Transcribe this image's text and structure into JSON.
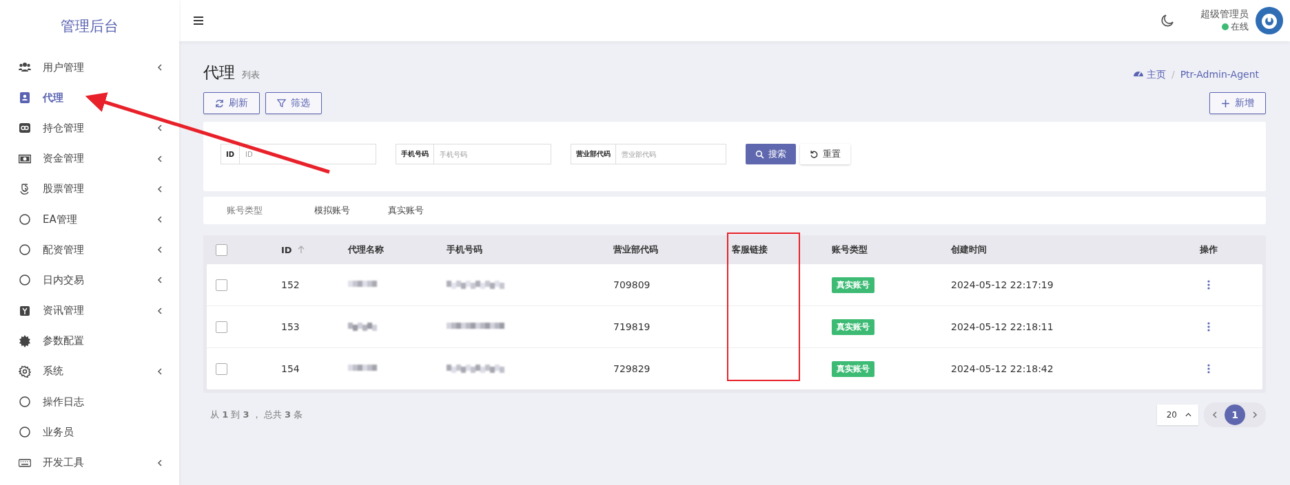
{
  "sidebar": {
    "title": "管理后台",
    "items": [
      {
        "label": "用户管理",
        "selected": false,
        "submenu": true
      },
      {
        "label": "代理",
        "selected": true,
        "submenu": false
      },
      {
        "label": "持仓管理",
        "selected": false,
        "submenu": true
      },
      {
        "label": "资金管理",
        "selected": false,
        "submenu": true
      },
      {
        "label": "股票管理",
        "selected": false,
        "submenu": true
      },
      {
        "label": "EA管理",
        "selected": false,
        "submenu": true
      },
      {
        "label": "配资管理",
        "selected": false,
        "submenu": true
      },
      {
        "label": "日内交易",
        "selected": false,
        "submenu": true
      },
      {
        "label": "资讯管理",
        "selected": false,
        "submenu": true
      },
      {
        "label": "参数配置",
        "selected": false,
        "submenu": false
      },
      {
        "label": "系统",
        "selected": false,
        "submenu": true
      },
      {
        "label": "操作日志",
        "selected": false,
        "submenu": false
      },
      {
        "label": "业务员",
        "selected": false,
        "submenu": false
      },
      {
        "label": "开发工具",
        "selected": false,
        "submenu": true
      }
    ]
  },
  "topbar": {
    "user": "超级管理员",
    "status": "在线"
  },
  "header": {
    "title": "代理",
    "subtitle": "列表",
    "breadcrumb": [
      "主页",
      "Ptr-Admin-Agent"
    ],
    "breadcrumb_separator": "/"
  },
  "toolbar": {
    "buttons": [
      "刷新",
      "筛选"
    ],
    "create": "新增"
  },
  "filters": {
    "fields": [
      {
        "label": "ID",
        "placeholder": "ID"
      },
      {
        "label": "手机号码",
        "placeholder": "手机号码"
      },
      {
        "label": "营业部代码",
        "placeholder": "营业部代码"
      }
    ],
    "search": "搜索",
    "reset": "重置"
  },
  "account_tabs": {
    "label": "账号类型",
    "tabs": [
      {
        "label": "模拟账号",
        "selected": false
      },
      {
        "label": "真实账号",
        "selected": false
      }
    ]
  },
  "table": {
    "columns": [
      "ID",
      "代理名称",
      "手机号码",
      "营业部代码",
      "客服链接",
      "账号类型",
      "创建时间",
      "操作"
    ],
    "header_checked": false,
    "rows": [
      {
        "checked": false,
        "id": "152",
        "branch_code": "709809",
        "account_type": "真实账号",
        "created": "2024-05-12 22:17:19"
      },
      {
        "checked": false,
        "id": "153",
        "branch_code": "719819",
        "account_type": "真实账号",
        "created": "2024-05-12 22:18:11"
      },
      {
        "checked": false,
        "id": "154",
        "branch_code": "729829",
        "account_type": "真实账号",
        "created": "2024-05-12 22:18:42"
      }
    ]
  },
  "footer": {
    "summary": "从 **1** 到 **3** ， 总共 **3** 条",
    "page_size": "20",
    "pages": [
      {
        "label": "1",
        "selected": true
      }
    ]
  }
}
